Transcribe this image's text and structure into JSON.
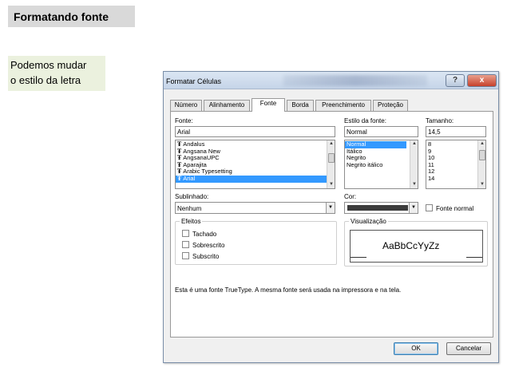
{
  "slide": {
    "title": "Formatando fonte",
    "note_line1": "Podemos mudar",
    "note_line2": "o estilo da  letra"
  },
  "dialog": {
    "title": "Formatar Células",
    "help_label": "?",
    "close_label": "x",
    "tabs": [
      "Número",
      "Alinhamento",
      "Fonte",
      "Borda",
      "Preenchimento",
      "Proteção"
    ],
    "active_tab": "Fonte",
    "font": {
      "label": "Fonte:",
      "value": "Arial",
      "items": [
        "Andalus",
        "Angsana New",
        "AngsanaUPC",
        "Aparajita",
        "Arabic Typesetting",
        "Arial"
      ],
      "selected": "Arial",
      "item_icon": "truetype-icon"
    },
    "style": {
      "label": "Estilo da fonte:",
      "value": "Normal",
      "items": [
        "Normal",
        "Itálico",
        "Negrito",
        "Negrito itálico"
      ],
      "selected": "Normal"
    },
    "size": {
      "label": "Tamanho:",
      "value": "14,5",
      "items": [
        "8",
        "9",
        "10",
        "11",
        "12",
        "14"
      ],
      "selected": "14"
    },
    "underline": {
      "label": "Sublinhado:",
      "value": "Nenhum"
    },
    "color": {
      "label": "Cor:",
      "swatch": "#3c3c3c"
    },
    "normal_font": {
      "label": "Fonte normal",
      "checked": false
    },
    "effects": {
      "label": "Efeitos",
      "items": [
        {
          "label": "Tachado",
          "checked": false
        },
        {
          "label": "Sobrescrito",
          "checked": false
        },
        {
          "label": "Subscrito",
          "checked": false
        }
      ]
    },
    "preview": {
      "label": "Visualização",
      "sample": "AaBbCcYyZz"
    },
    "description": "Esta é uma fonte TrueType. A mesma fonte será usada na impressora e na tela.",
    "ok_label": "OK",
    "cancel_label": "Cancelar",
    "colors": {
      "selection": "#3399ff",
      "title_bar": "#c5d4e8",
      "close_button": "#c7412b"
    }
  }
}
